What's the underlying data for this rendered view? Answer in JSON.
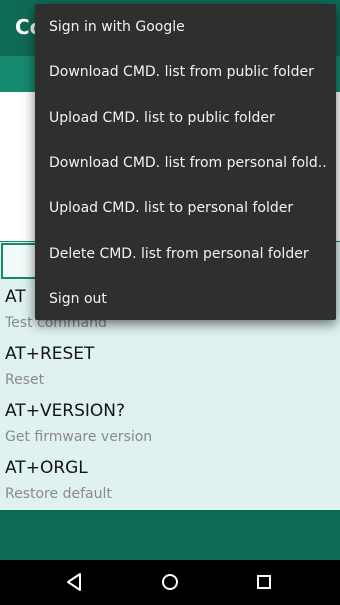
{
  "app_bar": {
    "title": "Co"
  },
  "commands": [
    {
      "name": "AT",
      "description": "Test command"
    },
    {
      "name": "AT+RESET",
      "description": "Reset"
    },
    {
      "name": "AT+VERSION?",
      "description": "Get firmware version"
    },
    {
      "name": "AT+ORGL",
      "description": "Restore default"
    }
  ],
  "overflow_menu": {
    "items": [
      {
        "label": "Sign in with Google"
      },
      {
        "label": "Download CMD. list from public folder"
      },
      {
        "label": "Upload CMD. list to public folder"
      },
      {
        "label": "Download CMD. list from personal fold.."
      },
      {
        "label": "Upload CMD. list to personal folder"
      },
      {
        "label": "Delete CMD. list from personal folder"
      },
      {
        "label": "Sign out"
      }
    ]
  },
  "navigation": {
    "back_icon": "back-triangle-icon",
    "home_icon": "home-circle-icon",
    "recents_icon": "recents-square-icon"
  },
  "colors": {
    "primary_dark": "#0f6a55",
    "primary": "#168a6e",
    "list_background": "#dff1f1",
    "menu_background": "#2f2f2f"
  }
}
